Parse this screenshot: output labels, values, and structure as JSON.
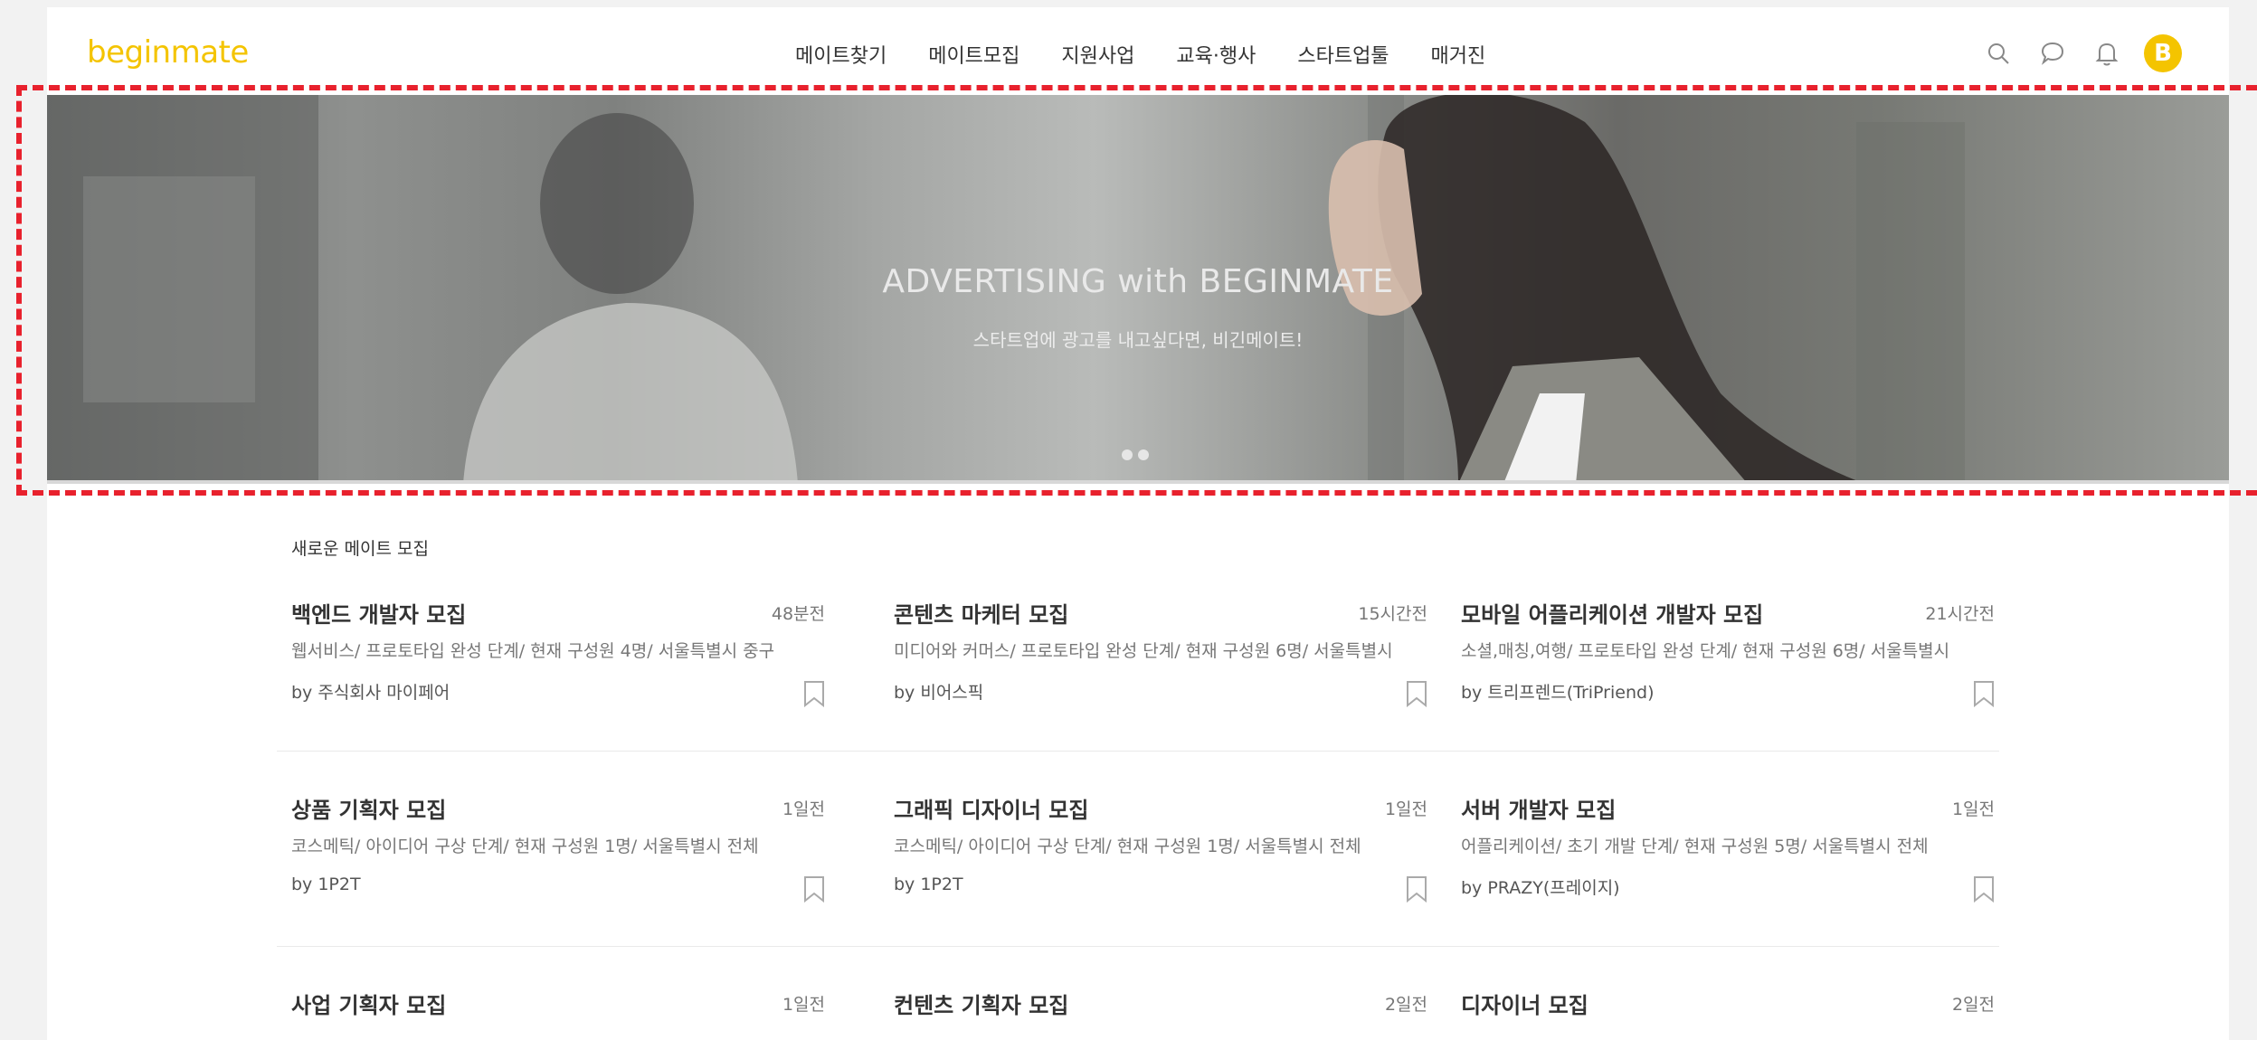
{
  "header": {
    "logo": "beginmate",
    "nav": [
      "메이트찾기",
      "메이트모집",
      "지원사업",
      "교육·행사",
      "스타트업툴",
      "매거진"
    ],
    "avatar_letter": "B",
    "icons": [
      "search-icon",
      "chat-icon",
      "bell-icon"
    ]
  },
  "hero": {
    "title": "ADVERTISING with BEGINMATE",
    "subtitle": "스타트업에 광고를 내고싶다면, 비긴메이트!",
    "slide_count": 2
  },
  "section": {
    "title": "새로운 메이트 모집"
  },
  "cards": [
    {
      "title": "백엔드 개발자 모집",
      "time": "48분전",
      "desc": "웹서비스/ 프로토타입 완성 단계/ 현재 구성원 4명/ 서울특별시 중구",
      "by": "by 주식회사 마이페어"
    },
    {
      "title": "콘텐츠 마케터 모집",
      "time": "15시간전",
      "desc": "미디어와 커머스/ 프로토타입 완성 단계/ 현재 구성원 6명/ 서울특별시",
      "by": "by 비어스픽"
    },
    {
      "title": "모바일 어플리케이션 개발자 모집",
      "time": "21시간전",
      "desc": "소셜,매칭,여행/ 프로토타입 완성 단계/ 현재 구성원 6명/ 서울특별시",
      "by": "by 트리프렌드(TriPriend)"
    },
    {
      "title": "상품 기획자 모집",
      "time": "1일전",
      "desc": "코스메틱/ 아이디어 구상 단계/ 현재 구성원 1명/ 서울특별시 전체",
      "by": "by 1P2T"
    },
    {
      "title": "그래픽 디자이너 모집",
      "time": "1일전",
      "desc": "코스메틱/ 아이디어 구상 단계/ 현재 구성원 1명/ 서울특별시 전체",
      "by": "by 1P2T"
    },
    {
      "title": "서버 개발자 모집",
      "time": "1일전",
      "desc": "어플리케이션/ 초기 개발 단계/ 현재 구성원 5명/ 서울특별시 전체",
      "by": "by PRAZY(프레이지)"
    },
    {
      "title": "사업 기획자 모집",
      "time": "1일전",
      "desc": "",
      "by": ""
    },
    {
      "title": "컨텐츠 기획자 모집",
      "time": "2일전",
      "desc": "",
      "by": ""
    },
    {
      "title": "디자이너 모집",
      "time": "2일전",
      "desc": "",
      "by": ""
    }
  ],
  "colors": {
    "brand": "#f4c400",
    "annotation": "#e8212d"
  }
}
